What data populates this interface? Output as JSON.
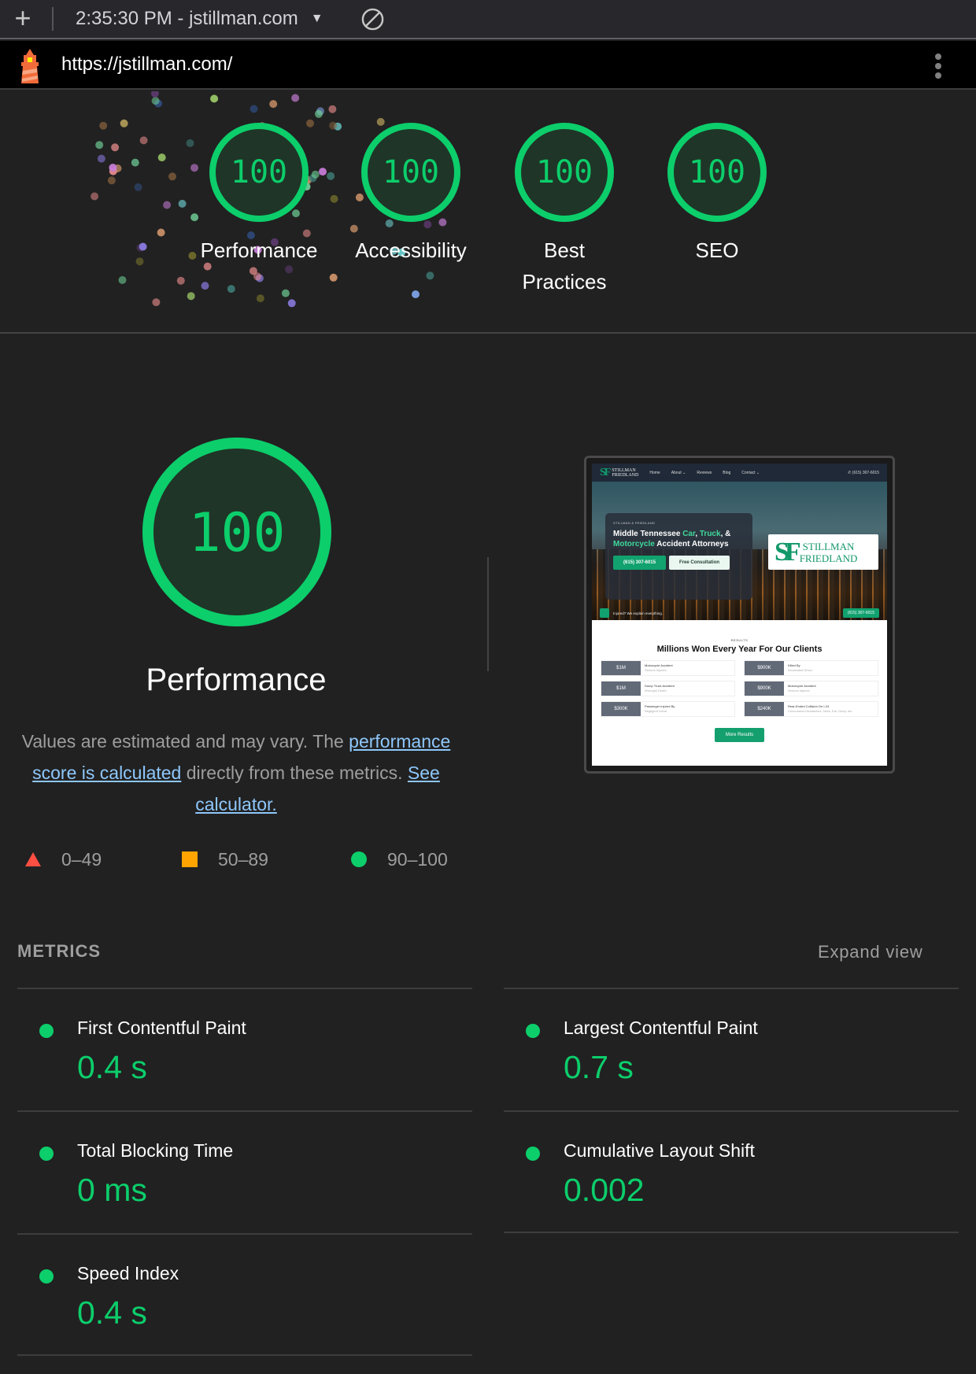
{
  "toolbar": {
    "new_report_icon": "plus-icon",
    "report_selector": "2:35:30 PM - jstillman.com",
    "dropdown_icon": "triangle-down-icon",
    "clear_icon": "block-icon"
  },
  "urlbar": {
    "logo_icon": "lighthouse-icon",
    "url": "https://jstillman.com/",
    "menu_icon": "kebab-menu-icon"
  },
  "gauges": [
    {
      "score": "100",
      "label": "Performance",
      "fraction": 1.0
    },
    {
      "score": "100",
      "label": "Accessibility",
      "fraction": 1.0
    },
    {
      "score": "100",
      "label": "Best Practices",
      "fraction": 1.0
    },
    {
      "score": "100",
      "label": "SEO",
      "fraction": 1.0
    }
  ],
  "performance": {
    "score": "100",
    "fraction": 1.0,
    "title": "Performance",
    "desc_part1": "Values are estimated and may vary. The ",
    "link1": "performance score is calculated",
    "desc_part2": " directly from these metrics. ",
    "link2": "See calculator."
  },
  "legend": [
    {
      "range": "0–49",
      "icon": "red-triangle-icon"
    },
    {
      "range": "50–89",
      "icon": "orange-square-icon"
    },
    {
      "range": "90–100",
      "icon": "green-circle-icon"
    }
  ],
  "colors": {
    "pass": "#0cce6b",
    "average": "#ffa400",
    "fail": "#ff4e42",
    "gauge_fill": "#1f3527",
    "link": "#8ec7fb"
  },
  "thumbnail": {
    "nav": [
      "Home",
      "About ⌄",
      "Reviews",
      "Blog",
      "Contact ⌄"
    ],
    "logo_top": "STILLMAN",
    "logo_bottom": "FRIEDLAND",
    "logo_mark": "SF",
    "phone": "(615) 307-6015",
    "eyebrow": "STILLMAN & FRIEDLAND",
    "headline_a": "Middle Tennessee ",
    "headline_car": "Car",
    "headline_comma": ", ",
    "headline_truck": "Truck",
    "headline_b": ", & ",
    "headline_moto": "Motorcycle",
    "headline_c": " Accident Attorneys",
    "btn_call": "(615) 307-6015",
    "btn_consult": "Free Consultation",
    "strip_text": "Injured? We explain everything.",
    "strip_phone": "(615) 307-6015",
    "results_eyebrow": "RESULTS",
    "results_title": "Millions Won Every Year For Our Clients",
    "results": [
      {
        "amount": "$1M",
        "title": "Motorcycle Accident",
        "sub": "Serious Injuries"
      },
      {
        "amount": "$900K",
        "title": "Killed By",
        "sub": "Intoxicated Driver"
      },
      {
        "amount": "$1M",
        "title": "Dump Truck Accident",
        "sub": "Wrongful Death"
      },
      {
        "amount": "$900K",
        "title": "Motorcycle Accident",
        "sub": "Serious Injuries"
      },
      {
        "amount": "$300K",
        "title": "Passenger Injured By",
        "sub": "Negligent Driver"
      },
      {
        "amount": "$240K",
        "title": "Rear-Ended Collision On I-24",
        "sub": "Concussion-Headaches, Neck, Ear, Dizzy, etc."
      }
    ],
    "more_button": "More Results"
  },
  "metrics": {
    "header": "METRICS",
    "expand": "Expand view",
    "items": [
      {
        "name": "First Contentful Paint",
        "value": "0.4 s",
        "status": "pass"
      },
      {
        "name": "Largest Contentful Paint",
        "value": "0.7 s",
        "status": "pass"
      },
      {
        "name": "Total Blocking Time",
        "value": "0 ms",
        "status": "pass"
      },
      {
        "name": "Cumulative Layout Shift",
        "value": "0.002",
        "status": "pass"
      },
      {
        "name": "Speed Index",
        "value": "0.4 s",
        "status": "pass"
      }
    ]
  }
}
